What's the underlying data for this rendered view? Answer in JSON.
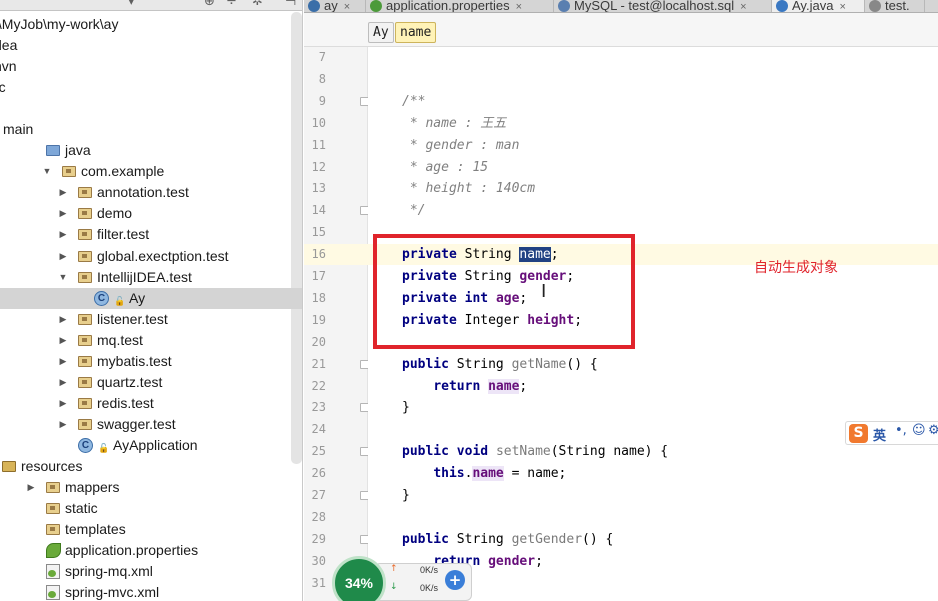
{
  "project_tree": {
    "toolbar_icons": [
      "gear-icon",
      "settings-icon",
      "hide-icon"
    ],
    "rows": [
      {
        "label": ":\\MyJob\\my-work\\ay",
        "indent": 0,
        "arrow": "",
        "icon": ""
      },
      {
        "label": "dea",
        "indent": 0,
        "arrow": "",
        "icon": ""
      },
      {
        "label": "nvn",
        "indent": 0,
        "arrow": "",
        "icon": ""
      },
      {
        "label": "rc",
        "indent": 0,
        "arrow": "",
        "icon": ""
      },
      {
        "label": "",
        "indent": 0,
        "arrow": "",
        "icon": ""
      },
      {
        "label": "main",
        "indent": 0,
        "arrow": "",
        "icon": ""
      },
      {
        "label": "java",
        "indent": 1,
        "arrow": "",
        "icon": "src"
      },
      {
        "label": "com.example",
        "indent": 2,
        "arrow": "open",
        "icon": "pkg"
      },
      {
        "label": "annotation.test",
        "indent": 3,
        "arrow": "closed",
        "icon": "pkg"
      },
      {
        "label": "demo",
        "indent": 3,
        "arrow": "closed",
        "icon": "pkg"
      },
      {
        "label": "filter.test",
        "indent": 3,
        "arrow": "closed",
        "icon": "pkg"
      },
      {
        "label": "global.exectption.test",
        "indent": 3,
        "arrow": "closed",
        "icon": "pkg"
      },
      {
        "label": "IntellijIDEA.test",
        "indent": 3,
        "arrow": "open",
        "icon": "pkg"
      },
      {
        "label": "Ay",
        "indent": 4,
        "arrow": "",
        "icon": "class"
      },
      {
        "label": "listener.test",
        "indent": 3,
        "arrow": "closed",
        "icon": "pkg"
      },
      {
        "label": "mq.test",
        "indent": 3,
        "arrow": "closed",
        "icon": "pkg"
      },
      {
        "label": "mybatis.test",
        "indent": 3,
        "arrow": "closed",
        "icon": "pkg"
      },
      {
        "label": "quartz.test",
        "indent": 3,
        "arrow": "closed",
        "icon": "pkg"
      },
      {
        "label": "redis.test",
        "indent": 3,
        "arrow": "closed",
        "icon": "pkg"
      },
      {
        "label": "swagger.test",
        "indent": 3,
        "arrow": "closed",
        "icon": "pkg"
      },
      {
        "label": "AyApplication",
        "indent": 3,
        "arrow": "",
        "icon": "app"
      },
      {
        "label": "resources",
        "indent": 0,
        "arrow": "",
        "icon": "res"
      },
      {
        "label": "mappers",
        "indent": 1,
        "arrow": "closed",
        "icon": "pkg"
      },
      {
        "label": "static",
        "indent": 1,
        "arrow": "",
        "icon": "pkg"
      },
      {
        "label": "templates",
        "indent": 1,
        "arrow": "",
        "icon": "pkg"
      },
      {
        "label": "application.properties",
        "indent": 1,
        "arrow": "",
        "icon": "leaf"
      },
      {
        "label": "spring-mq.xml",
        "indent": 1,
        "arrow": "",
        "icon": "xml"
      },
      {
        "label": "spring-mvc.xml",
        "indent": 1,
        "arrow": "",
        "icon": "xml"
      }
    ]
  },
  "tabs": [
    {
      "label": "ay",
      "close": "×",
      "color": "#3a6ea8",
      "active": false
    },
    {
      "label": "application.properties",
      "close": "×",
      "color": "#4c9a3a",
      "active": false
    },
    {
      "label": "MySQL - test@localhost.sql",
      "close": "×",
      "color": "#5a7fb0",
      "active": false
    },
    {
      "label": "Ay.java",
      "close": "×",
      "color": "#3a78c2",
      "active": true
    },
    {
      "label": "test.",
      "close": "",
      "color": "#888888",
      "active": false
    }
  ],
  "breadcrumb": {
    "class_name": "Ay",
    "field_name": "name"
  },
  "editor": {
    "line_numbers": [
      "7",
      "8",
      "9",
      "10",
      "11",
      "12",
      "13",
      "14",
      "15",
      "16",
      "17",
      "18",
      "19",
      "20",
      "21",
      "22",
      "23",
      "24",
      "25",
      "26",
      "27",
      "28",
      "29",
      "30",
      "31"
    ],
    "lines": [
      [],
      [],
      [
        {
          "t": "/**",
          "c": "cm"
        }
      ],
      [
        {
          "t": " * name : 王五",
          "c": "cm"
        }
      ],
      [
        {
          "t": " * gender : man",
          "c": "cm"
        }
      ],
      [
        {
          "t": " * age : 15",
          "c": "cm"
        }
      ],
      [
        {
          "t": " * height : 140cm",
          "c": "cm"
        }
      ],
      [
        {
          "t": " */",
          "c": "cm"
        }
      ],
      [],
      [
        {
          "t": "private",
          "c": "kw"
        },
        {
          "t": " String ",
          "c": ""
        },
        {
          "t": "name",
          "c": "sel"
        },
        {
          "t": ";",
          "c": ""
        }
      ],
      [
        {
          "t": "private",
          "c": "kw"
        },
        {
          "t": " String ",
          "c": ""
        },
        {
          "t": "gender",
          "c": "fld"
        },
        {
          "t": ";",
          "c": ""
        }
      ],
      [
        {
          "t": "private",
          "c": "kw"
        },
        {
          "t": " ",
          "c": ""
        },
        {
          "t": "int",
          "c": "kw"
        },
        {
          "t": " ",
          "c": ""
        },
        {
          "t": "age",
          "c": "fld"
        },
        {
          "t": ";",
          "c": ""
        }
      ],
      [
        {
          "t": "private",
          "c": "kw"
        },
        {
          "t": " Integer ",
          "c": ""
        },
        {
          "t": "height",
          "c": "fld"
        },
        {
          "t": ";",
          "c": ""
        }
      ],
      [],
      [
        {
          "t": "public",
          "c": "kw"
        },
        {
          "t": " String ",
          "c": ""
        },
        {
          "t": "getName",
          "c": "mth"
        },
        {
          "t": "() {",
          "c": ""
        }
      ],
      [
        {
          "t": "    ",
          "c": ""
        },
        {
          "t": "return",
          "c": "kw"
        },
        {
          "t": " ",
          "c": ""
        },
        {
          "t": "name",
          "c": "fld ref"
        },
        {
          "t": ";",
          "c": ""
        }
      ],
      [
        {
          "t": "}",
          "c": ""
        }
      ],
      [],
      [
        {
          "t": "public",
          "c": "kw"
        },
        {
          "t": " ",
          "c": ""
        },
        {
          "t": "void",
          "c": "kw"
        },
        {
          "t": " ",
          "c": ""
        },
        {
          "t": "setName",
          "c": "mth"
        },
        {
          "t": "(String name) {",
          "c": ""
        }
      ],
      [
        {
          "t": "    ",
          "c": ""
        },
        {
          "t": "this",
          "c": "kw"
        },
        {
          "t": ".",
          "c": ""
        },
        {
          "t": "name",
          "c": "fld ref"
        },
        {
          "t": " = name;",
          "c": ""
        }
      ],
      [
        {
          "t": "}",
          "c": ""
        }
      ],
      [],
      [
        {
          "t": "public",
          "c": "kw"
        },
        {
          "t": " String ",
          "c": ""
        },
        {
          "t": "getGender",
          "c": "mth"
        },
        {
          "t": "() {",
          "c": ""
        }
      ],
      [
        {
          "t": "    ",
          "c": ""
        },
        {
          "t": "return",
          "c": "kw"
        },
        {
          "t": " ",
          "c": ""
        },
        {
          "t": "gender",
          "c": "fld"
        },
        {
          "t": ";",
          "c": ""
        }
      ],
      []
    ],
    "fold_marks": [
      "9",
      "14",
      "21",
      "23",
      "25",
      "27",
      "29"
    ]
  },
  "annotation": {
    "text": "自动生成对象",
    "color": "#e0242b"
  },
  "ime_toolbar": {
    "logo": "S",
    "lang": "英",
    "punct": "•,",
    "emoji": "☺",
    "more": "⚙"
  },
  "net_widget": {
    "percent": "34%",
    "up_arrow": "↑",
    "down_arrow": "↓",
    "upload": "0K/s",
    "download": "0K/s",
    "plus": "+"
  },
  "colors": {
    "keyword": "#000080",
    "field": "#660e7a",
    "comment": "#808080",
    "selection": "#214283",
    "annotation": "#e0242b"
  }
}
